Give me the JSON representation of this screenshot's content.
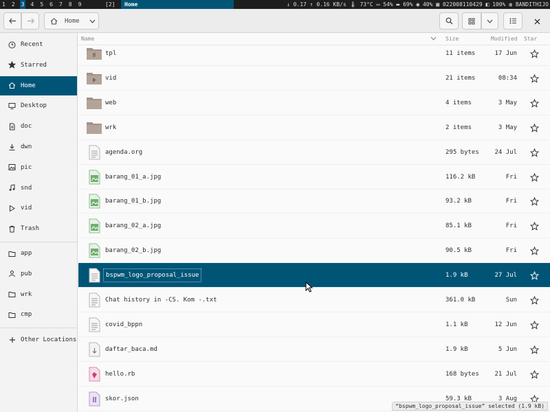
{
  "statusbar": {
    "workspaces": [
      "1",
      "2",
      "3",
      "4",
      "5",
      "6",
      "7",
      "8",
      "9"
    ],
    "active_workspace": "3",
    "layout": "[2]",
    "window_title": "Home",
    "right": "↓ 0.17 ↑ 0.16 KB/s 🌡 73°C ▭ 54% ▬ 69% ◉ 40% ▦ 022008110429 ◧ 100% ◍ BANDITHIJO"
  },
  "header": {
    "location": "Home"
  },
  "columns": {
    "name": "Name",
    "size": "Size",
    "modified": "Modified",
    "star": "Star"
  },
  "sidebar": {
    "items": [
      {
        "label": "Recent",
        "icon": "clock-icon"
      },
      {
        "label": "Starred",
        "icon": "star-icon"
      },
      {
        "label": "Home",
        "icon": "home-icon"
      },
      {
        "label": "Desktop",
        "icon": "monitor-icon"
      },
      {
        "label": "doc",
        "icon": "document-icon"
      },
      {
        "label": "dwn",
        "icon": "download-icon"
      },
      {
        "label": "pic",
        "icon": "image-icon"
      },
      {
        "label": "snd",
        "icon": "music-icon"
      },
      {
        "label": "vid",
        "icon": "play-icon"
      },
      {
        "label": "Trash",
        "icon": "trash-icon"
      }
    ],
    "bookmarks": [
      {
        "label": "app",
        "icon": "folder-icon"
      },
      {
        "label": "pub",
        "icon": "person-icon"
      },
      {
        "label": "wrk",
        "icon": "folder-icon"
      },
      {
        "label": "cmp",
        "icon": "folder-icon"
      }
    ],
    "other_locations": "Other Locations"
  },
  "files": [
    {
      "name": "tpl",
      "size": "11 items",
      "modified": "17 Jun",
      "type": "folder-template"
    },
    {
      "name": "vid",
      "size": "21 items",
      "modified": "08:34",
      "type": "folder-video"
    },
    {
      "name": "web",
      "size": "4 items",
      "modified": "3 May",
      "type": "folder"
    },
    {
      "name": "wrk",
      "size": "2 items",
      "modified": "3 May",
      "type": "folder"
    },
    {
      "name": "agenda.org",
      "size": "295 bytes",
      "modified": "24 Jul",
      "type": "text"
    },
    {
      "name": "barang_01_a.jpg",
      "size": "116.2 kB",
      "modified": "Fri",
      "type": "image"
    },
    {
      "name": "barang_01_b.jpg",
      "size": "93.2 kB",
      "modified": "Fri",
      "type": "image"
    },
    {
      "name": "barang_02_a.jpg",
      "size": "85.1 kB",
      "modified": "Fri",
      "type": "image"
    },
    {
      "name": "barang_02_b.jpg",
      "size": "90.5 kB",
      "modified": "Fri",
      "type": "image"
    },
    {
      "name": "bspwm_logo_proposal_issue",
      "size": "1.9 kB",
      "modified": "27 Jul",
      "type": "text",
      "selected": true
    },
    {
      "name": "Chat history in -CS. Kom -.txt",
      "size": "361.0 kB",
      "modified": "Sun",
      "type": "text"
    },
    {
      "name": "covid_bppn",
      "size": "1.1 kB",
      "modified": "12 Jun",
      "type": "text"
    },
    {
      "name": "daftar_baca.md",
      "size": "1.9 kB",
      "modified": "5 Jun",
      "type": "markdown"
    },
    {
      "name": "hello.rb",
      "size": "168 bytes",
      "modified": "21 Jul",
      "type": "ruby"
    },
    {
      "name": "skor.json",
      "size": "59.3 kB",
      "modified": "3 Aug",
      "type": "json"
    }
  ],
  "status_label": "“bspwm_logo_proposal_issue” selected (1.9 kB)",
  "colors": {
    "accent": "#005577",
    "folder": "#a39389"
  }
}
